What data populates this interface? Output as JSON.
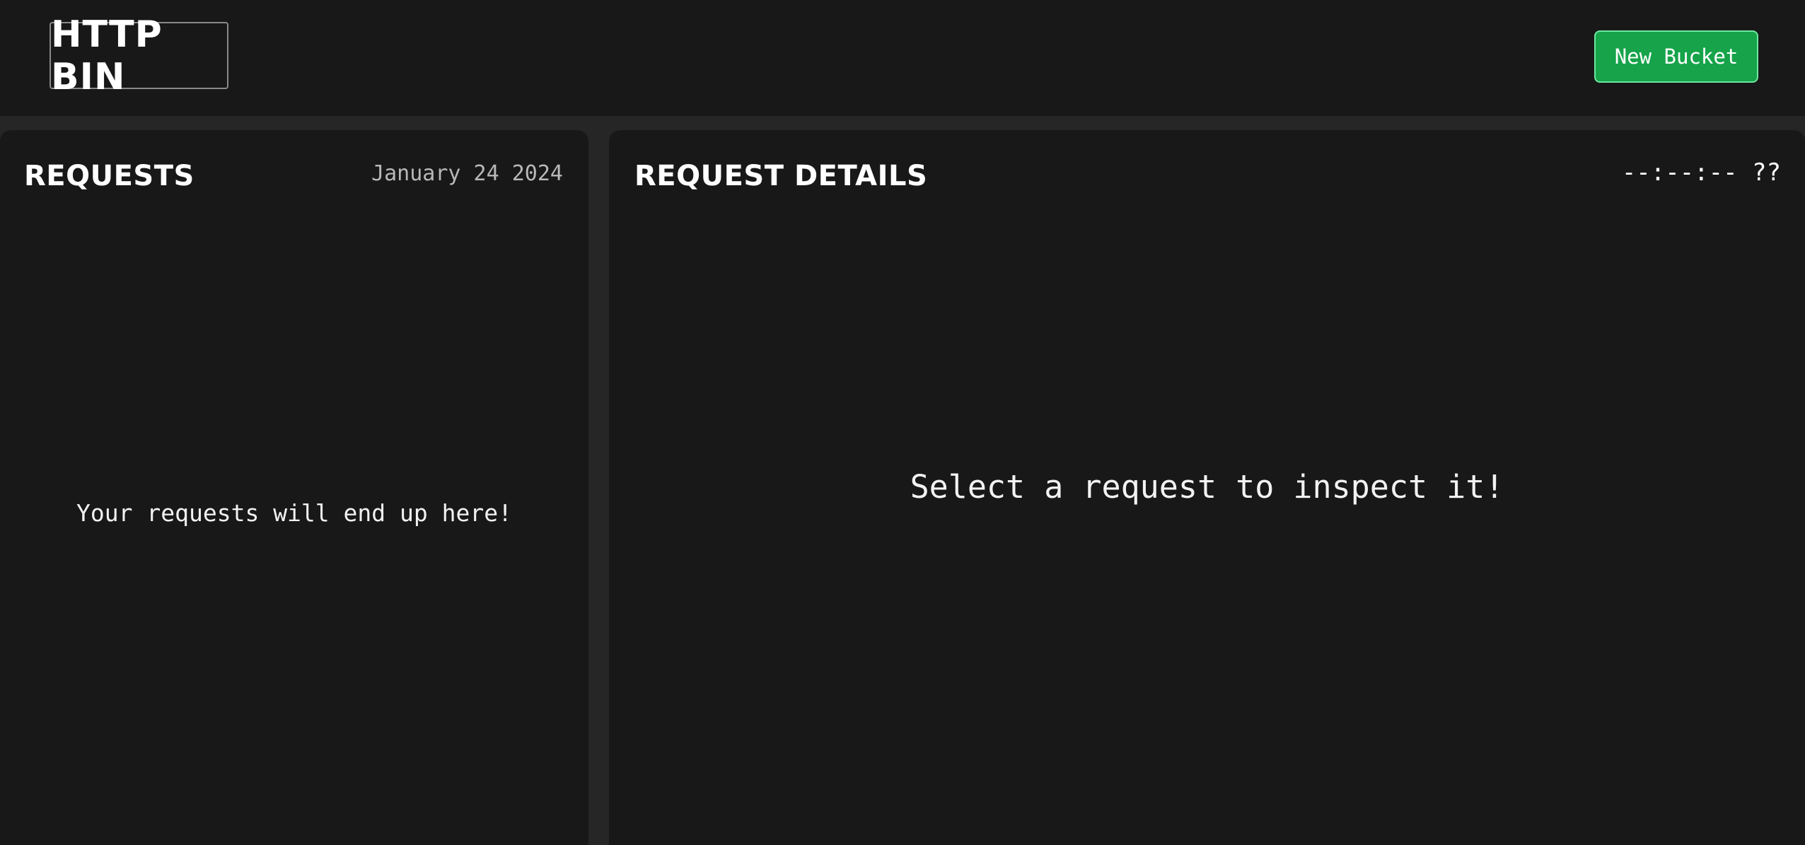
{
  "header": {
    "logo_text": "HTTP BIN",
    "new_bucket_label": "New Bucket"
  },
  "requests_panel": {
    "title": "REQUESTS",
    "date": "January 24 2024",
    "empty_message": "Your requests will end up here!"
  },
  "details_panel": {
    "title": "REQUEST DETAILS",
    "time": "--:--:-- ??",
    "empty_message": "Select a request to inspect it!"
  },
  "colors": {
    "background": "#181818",
    "gutter": "#262626",
    "accent": "#16a34a"
  }
}
